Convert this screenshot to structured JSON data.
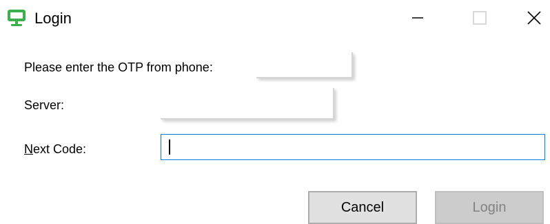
{
  "window": {
    "title": "Login",
    "icon": "monitor-icon",
    "controls": {
      "minimize_icon": "minimize-icon",
      "maximize_icon": "maximize-icon",
      "close_icon": "close-icon"
    }
  },
  "form": {
    "otp_label": "Please enter the OTP from phone:",
    "otp_value": "",
    "server_label": "Server:",
    "server_value": "",
    "next_code_label": "Next Code:",
    "next_code_mnemonic": "N",
    "next_code_label_rest": "ext Code:",
    "next_code_value": ""
  },
  "buttons": {
    "cancel_label": "Cancel",
    "login_label": "Login",
    "login_enabled": false
  },
  "colors": {
    "icon_green": "#34a853",
    "focus_border": "#0078d7",
    "disabled_text": "#838383"
  }
}
